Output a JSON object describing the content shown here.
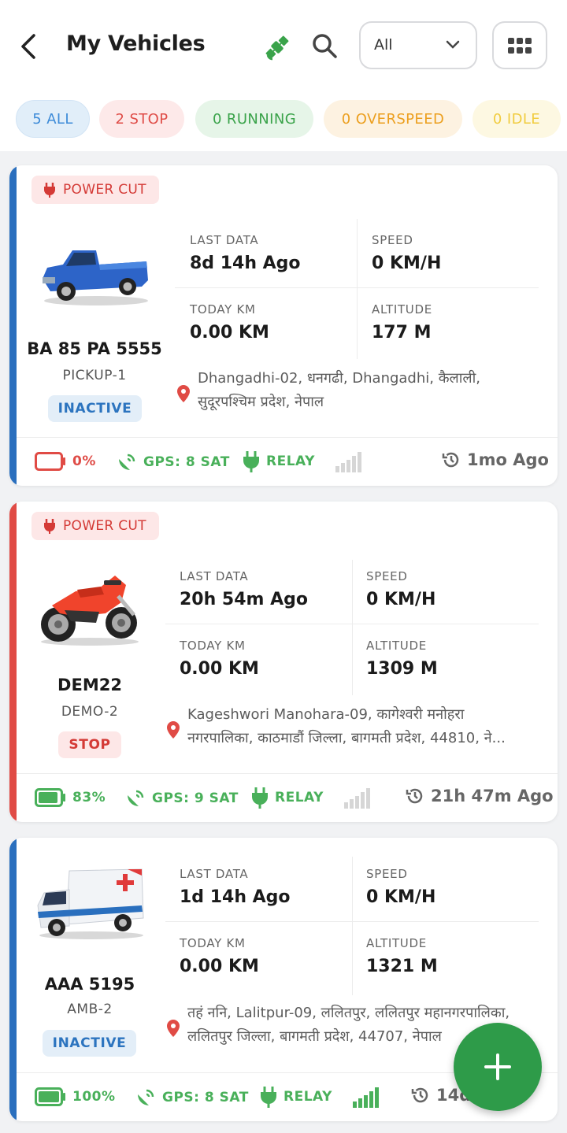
{
  "header": {
    "title": "My Vehicles",
    "filter_value": "All"
  },
  "chips": [
    {
      "label": "5 ALL",
      "color": "#3d8bd8"
    },
    {
      "label": "2 STOP",
      "color": "#df4c47"
    },
    {
      "label": "0 RUNNING",
      "color": "#3aa34a"
    },
    {
      "label": "0 OVERSPEED",
      "color": "#ec9f1e"
    },
    {
      "label": "0 IDLE",
      "color": "#f1cc3f"
    }
  ],
  "labels": {
    "last_data": "LAST DATA",
    "speed": "SPEED",
    "today_km": "TODAY KM",
    "altitude": "ALTITUDE",
    "power_cut": "POWER CUT"
  },
  "vehicles": [
    {
      "plate": "BA 85 PA 5555",
      "model": "PICKUP-1",
      "status": "INACTIVE",
      "vehicle_icon": "pickup-truck",
      "power_cut": true,
      "last_data": "8d 14h Ago",
      "speed": "0 KM/H",
      "today_km": "0.00 KM",
      "altitude": "177 M",
      "address_line1": "Dhangadhi-02, धनगढी, Dhangadhi, कैलाली,",
      "address_line2": "सुदूरपश्चिम प्रदेश, नेपाल",
      "battery": "0%",
      "battery_level": 0,
      "gps": "GPS: 8 SAT",
      "relay": "RELAY",
      "signal_bars_active": 0,
      "updated": "1mo Ago",
      "stripe_color": "#2a6fbe"
    },
    {
      "plate": "DEM22",
      "model": "DEMO-2",
      "status": "STOP",
      "vehicle_icon": "motorcycle",
      "power_cut": true,
      "last_data": "20h 54m Ago",
      "speed": "0 KM/H",
      "today_km": "0.00 KM",
      "altitude": "1309 M",
      "address_line1": "Kageshwori Manohara-09, कागेश्वरी मनोहरा",
      "address_line2": "नगरपालिका, काठमाडौं जिल्ला, बागमती प्रदेश, 44810, ने...",
      "battery": "83%",
      "battery_level": 0.83,
      "gps": "GPS: 9 SAT",
      "relay": "RELAY",
      "signal_bars_active": 0,
      "updated": "21h 47m Ago",
      "stripe_color": "#e04b45"
    },
    {
      "plate": "AAA 5195",
      "model": "AMB-2",
      "status": "INACTIVE",
      "vehicle_icon": "ambulance",
      "power_cut": false,
      "last_data": "1d 14h Ago",
      "speed": "0 KM/H",
      "today_km": "0.00 KM",
      "altitude": "1321 M",
      "address_line1": "तहं ननि, Lalitpur-09, ललितपुर, ललितपुर महानगरपालिका,",
      "address_line2": "ललितपुर जिल्ला, बागमती प्रदेश, 44707, नेपाल",
      "battery": "100%",
      "battery_level": 1,
      "gps": "GPS: 8 SAT",
      "relay": "RELAY",
      "signal_bars_active": 5,
      "updated": "14d Ago",
      "stripe_color": "#2a6fbe"
    }
  ]
}
